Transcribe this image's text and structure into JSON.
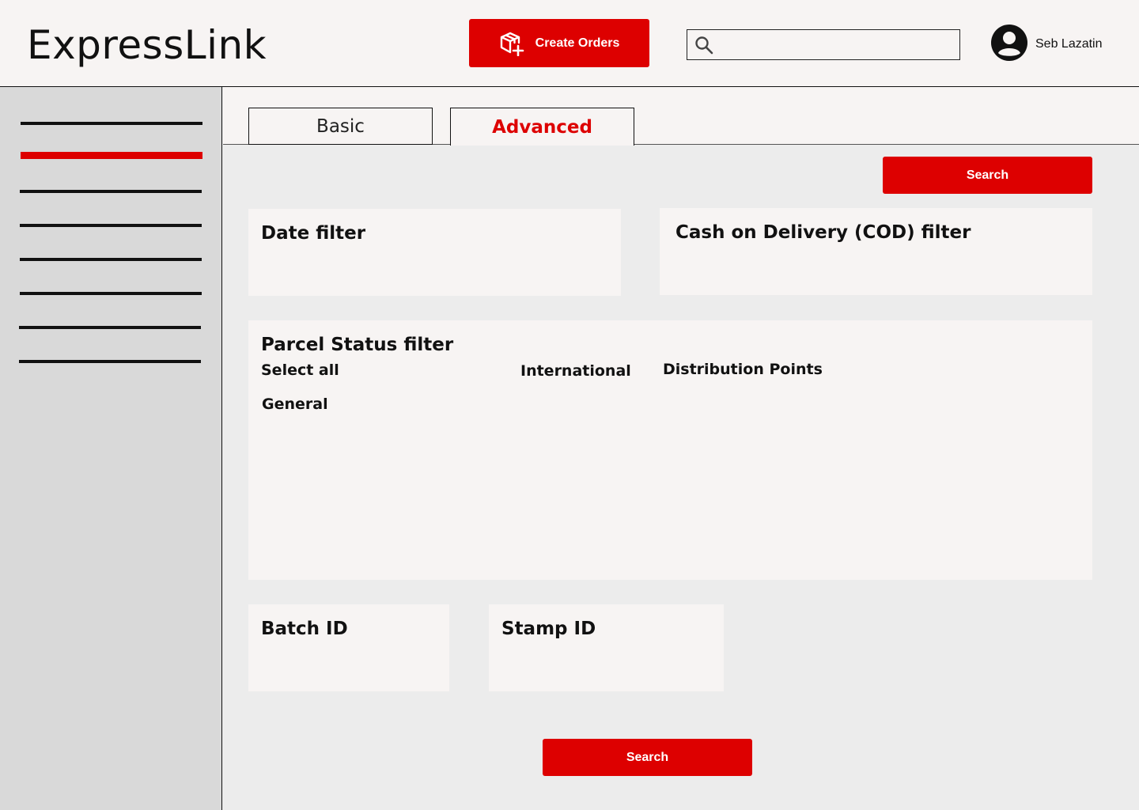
{
  "header": {
    "logo": "ExpressLink",
    "create_orders_label": "Create Orders",
    "search_placeholder": "",
    "user_name": "Seb Lazatin"
  },
  "sidebar": {
    "items": [
      {
        "active": false
      },
      {
        "active": true
      },
      {
        "active": false
      },
      {
        "active": false
      },
      {
        "active": false
      },
      {
        "active": false
      },
      {
        "active": false
      },
      {
        "active": false
      }
    ]
  },
  "tabs": {
    "basic": "Basic",
    "advanced": "Advanced",
    "selected": "advanced"
  },
  "actions": {
    "search_top": "Search",
    "search_bottom": "Search"
  },
  "filters": {
    "date": {
      "title": "Date filter"
    },
    "cod": {
      "title": "Cash on Delivery (COD) filter"
    },
    "parcel_status": {
      "title": "Parcel Status filter",
      "options": {
        "select_all": "Select all",
        "general": "General",
        "international": "International",
        "distribution_points": "Distribution Points"
      }
    },
    "batch_id": {
      "title": "Batch ID"
    },
    "stamp_id": {
      "title": "Stamp ID"
    }
  },
  "colors": {
    "accent": "#dd0000",
    "header_bg": "#f7f4f3",
    "sidebar_bg": "#d9d9d9",
    "main_bg": "#ececec"
  }
}
